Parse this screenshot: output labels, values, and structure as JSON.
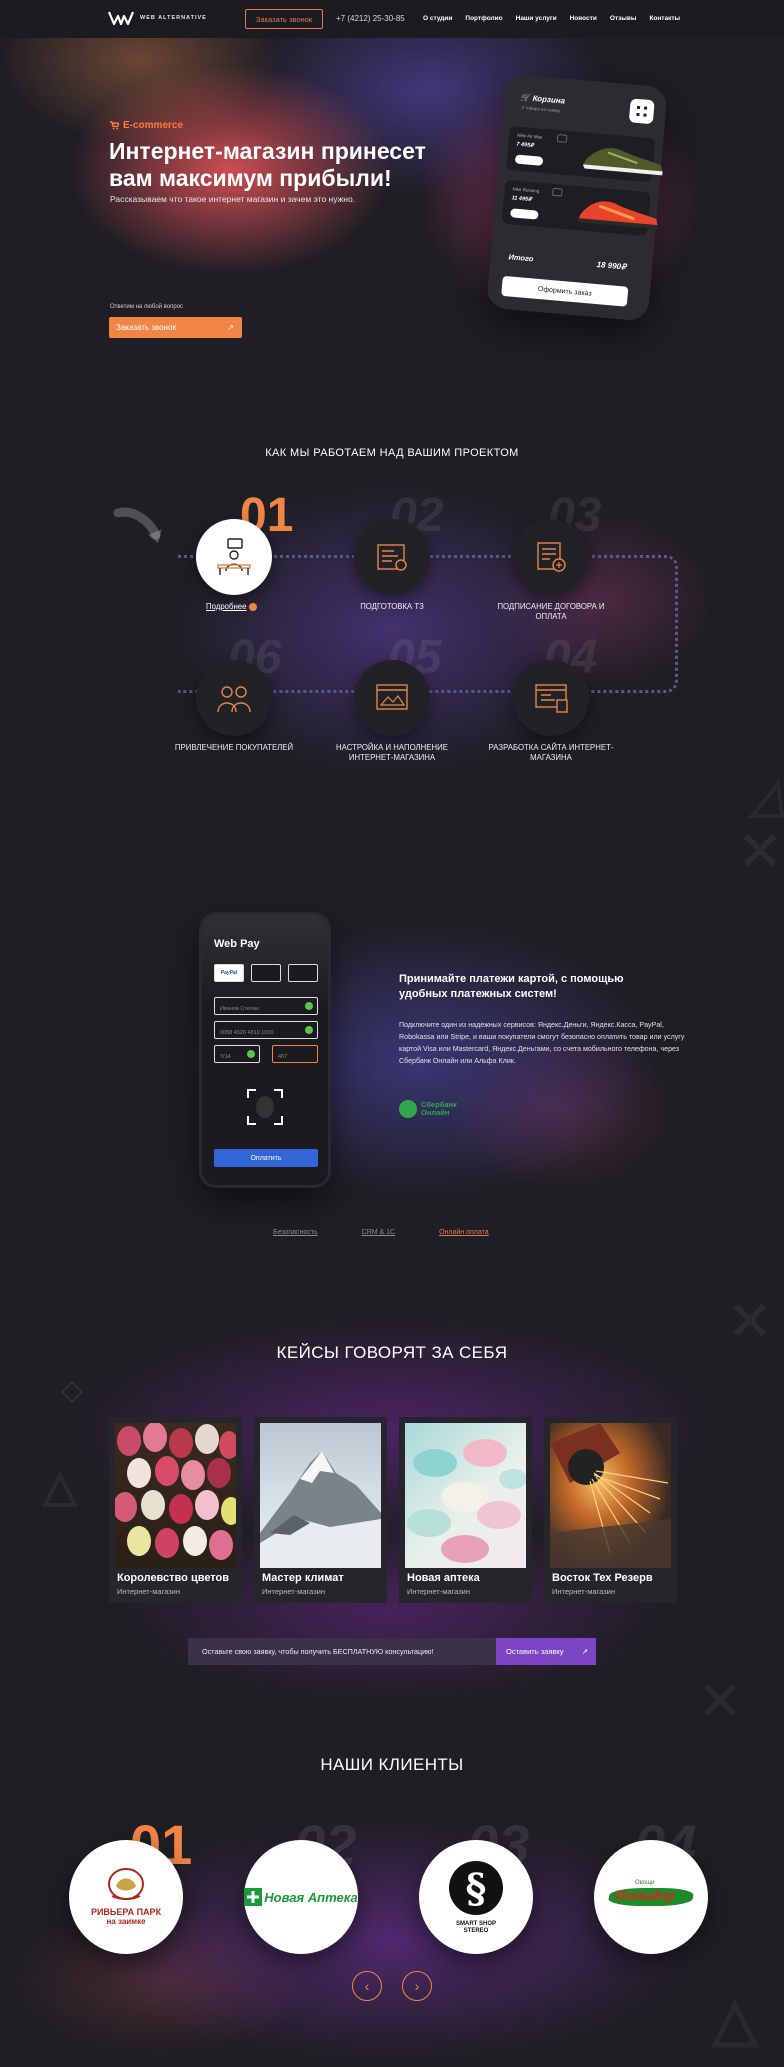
{
  "header": {
    "logo_text": "WEB ALTERNATIVE",
    "call_button": "Заказать звонок",
    "phone": "+7 (4212) 25-30-85",
    "nav": [
      "О студии",
      "Портфолио",
      "Наши услуги",
      "Новости",
      "Отзывы",
      "Контакты"
    ]
  },
  "hero": {
    "tag": "E-commerce",
    "title": "Интернет-магазин принесет вам максимум прибыли!",
    "subtitle": "Рассказываем что такое интернет магазин и зачем это нужно.",
    "ask_label": "Ответим на любой вопрос",
    "call_button": "Заказать звонок",
    "phone_mock": {
      "cart_title": "Корзина",
      "cart_sub": "2 товара на сумму",
      "products": [
        {
          "name": "Nike Air Max",
          "price": "7 495₽"
        },
        {
          "name": "Nike Running",
          "price": "11 495₽"
        }
      ],
      "total_label": "Итого",
      "total_value": "18 990₽",
      "order_button": "Оформить заказ"
    }
  },
  "process": {
    "title": "КАК МЫ РАБОТАЕМ НАД ВАШИМ ПРОЕКТОМ",
    "more_link": "Подробнее",
    "steps": [
      {
        "num": "01",
        "label": ""
      },
      {
        "num": "02",
        "label": "ПОДГОТОВКА ТЗ"
      },
      {
        "num": "03",
        "label": "ПОДПИСАНИЕ ДОГОВОРА И ОПЛАТА"
      },
      {
        "num": "04",
        "label": "РАЗРАБОТКА САЙТА ИНТЕРНЕТ-МАГАЗИНА"
      },
      {
        "num": "05",
        "label": "НАСТРОЙКА И НАПОЛНЕНИЕ ИНТЕРНЕТ-МАГАЗИНА"
      },
      {
        "num": "06",
        "label": "ПРИВЛЕЧЕНИЕ ПОКУПАТЕЛЕЙ"
      }
    ]
  },
  "payment": {
    "phone_title": "Web Pay",
    "paypal": "PayPal",
    "name_value": "Иванов Степан",
    "card_value": "0058 4526 4810 1030",
    "date_value": "7/14",
    "cvv_value": "467",
    "pay_button": "Оплатить",
    "title": "Принимайте платежи картой, с помощью удобных платежных систем!",
    "text": "Подключите один из надежных сервисов: Яндекс.Деньги, Яндекс.Касса, PayPal, Robokassa или Stripe, и ваши покупатели смогут безопасно оплатить товар или услугу картой Visa или Mastercard, Яндекс.Деньгами, со счета мобильного телефона, через Сбербанк Онлайн или Альфа Клик.",
    "sber_line1": "Сбербанк",
    "sber_line2": "Онлайн",
    "tabs": [
      "Безопасность",
      "CRM & 1C",
      "Онлайн оплата"
    ],
    "active_tab": 2
  },
  "cases": {
    "title": "КЕЙСЫ ГОВОРЯТ ЗА СЕБЯ",
    "items": [
      {
        "name": "Королевство цветов",
        "type": "Интернет-магазин"
      },
      {
        "name": "Мастер климат",
        "type": "Интернет-магазин"
      },
      {
        "name": "Новая аптека",
        "type": "Интернет-магазин"
      },
      {
        "name": "Восток Тех Резерв",
        "type": "Интернет-магазин"
      }
    ],
    "cta_text": "Оставьте свою заявку, чтобы получить БЕСПЛАТНУЮ консультацию!",
    "cta_button": "Оставить заявку"
  },
  "clients": {
    "title": "НАШИ КЛИЕНТЫ",
    "items": [
      {
        "num": "01",
        "logo_text": "РИВЬЕРА ПАРК",
        "logo_sub": "на заимке"
      },
      {
        "num": "02",
        "logo_text": "Новая Аптека",
        "logo_sub": ""
      },
      {
        "num": "03",
        "logo_text": "SMART SHOP STEREO",
        "logo_sub": ""
      },
      {
        "num": "04",
        "logo_text": "Помидор",
        "logo_sub": "Овощи"
      }
    ]
  },
  "colors": {
    "accent": "#f18545",
    "purple": "#7b45c3",
    "background": "#1f1e24"
  }
}
